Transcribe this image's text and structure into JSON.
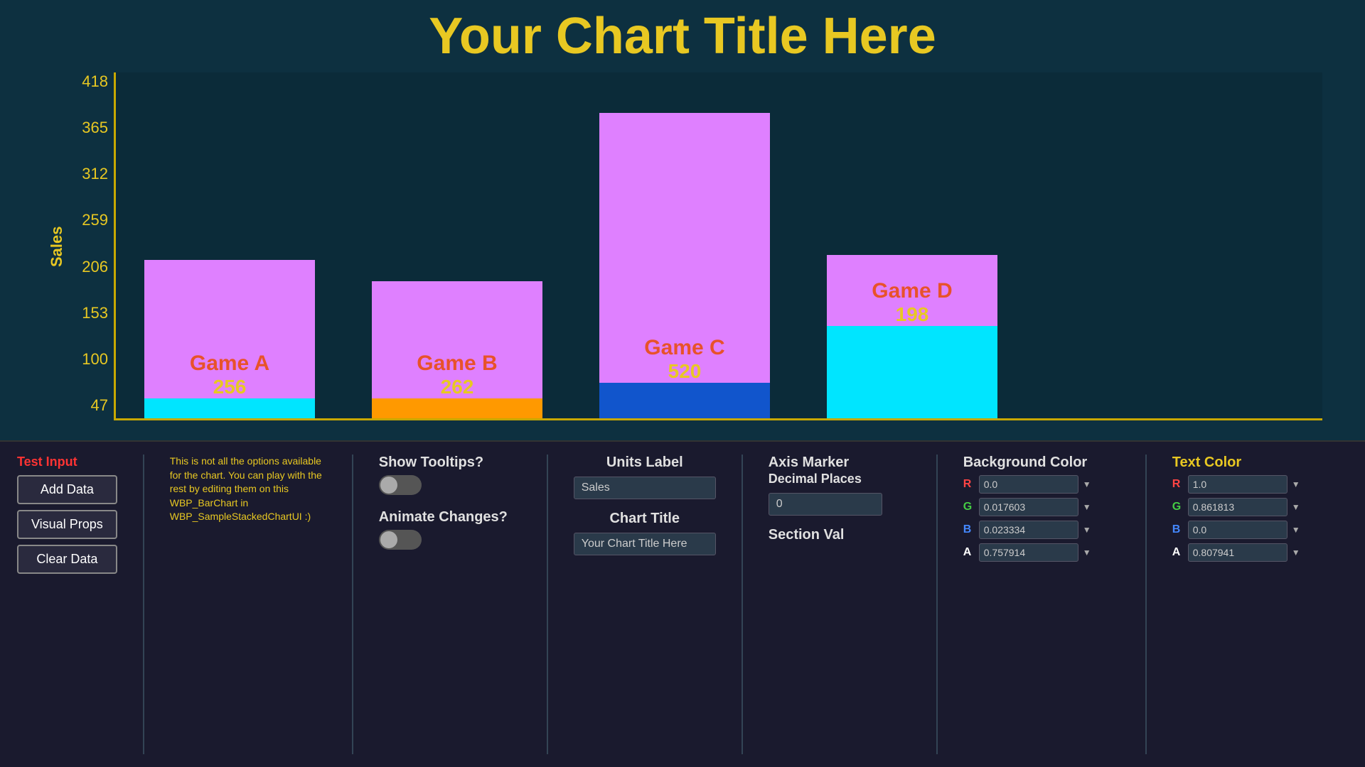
{
  "chart": {
    "title": "Your Chart Title Here",
    "y_axis_label": "Sales",
    "y_ticks": [
      "47",
      "100",
      "153",
      "206",
      "259",
      "312",
      "365",
      "418"
    ],
    "bars": [
      {
        "name": "Game A",
        "value": 256,
        "top_color": "#df80ff",
        "bottom_color": "#00e5ff",
        "top_height": 195,
        "bottom_height": 28
      },
      {
        "name": "Game B",
        "value": 262,
        "top_color": "#df80ff",
        "bottom_color": "#ff9900",
        "top_height": 165,
        "bottom_height": 28
      },
      {
        "name": "Game C",
        "value": 520,
        "top_color": "#df80ff",
        "bottom_color": "#1155cc",
        "top_height": 380,
        "bottom_height": 50
      },
      {
        "name": "Game D",
        "value": 198,
        "top_color": "#df80ff",
        "bottom_color": "#00e5ff",
        "top_height": 100,
        "bottom_height": 130
      }
    ]
  },
  "bottom": {
    "test_input_label": "Test Input",
    "add_data_label": "Add Data",
    "visual_props_label": "Visual Props",
    "clear_data_label": "Clear Data",
    "info_text": "This is not all the options available for the chart. You can play with the rest by editing them on this WBP_BarChart in WBP_SampleStackedChartUI :)",
    "show_tooltips_label": "Show Tooltips?",
    "animate_changes_label": "Animate Changes?",
    "units_label_title": "Units Label",
    "units_label_value": "Sales",
    "chart_title_label": "Chart Title",
    "chart_title_value": "Your Chart Title Here",
    "axis_marker_label": "Axis Marker",
    "decimal_places_label": "Decimal Places",
    "decimal_places_value": "0",
    "section_val_label": "Section Val",
    "bg_color_title": "Background Color",
    "bg_r": "0.0",
    "bg_g": "0.017603",
    "bg_b": "0.023334",
    "bg_a": "0.757914",
    "text_color_title": "Text Color",
    "text_r": "1.0",
    "text_g": "0.861813",
    "text_b": "0.0",
    "text_a": "0.807941"
  }
}
